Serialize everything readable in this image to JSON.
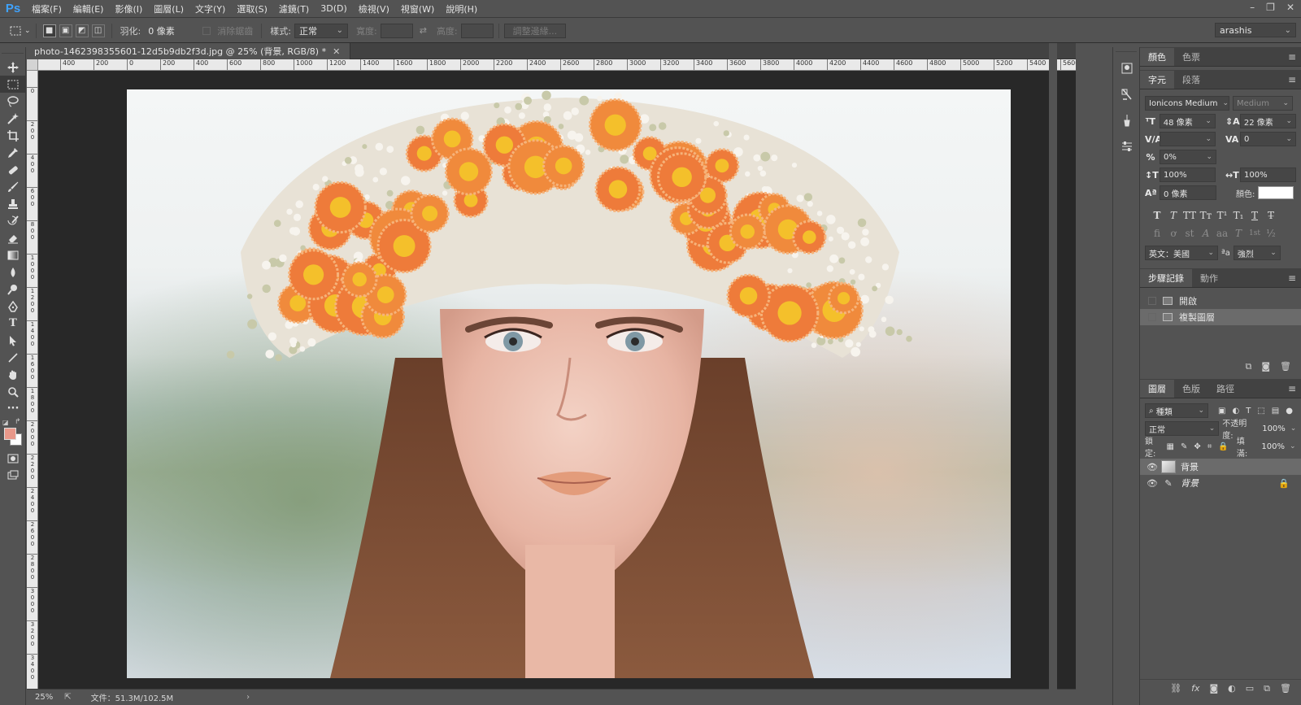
{
  "app": {
    "logo": "Ps"
  },
  "menu": [
    "檔案(F)",
    "編輯(E)",
    "影像(I)",
    "圖層(L)",
    "文字(Y)",
    "選取(S)",
    "濾鏡(T)",
    "3D(D)",
    "檢視(V)",
    "視窗(W)",
    "說明(H)"
  ],
  "options": {
    "feather_label": "羽化:",
    "feather_value": "0 像素",
    "antialias_label": "消除鋸齒",
    "style_label": "樣式:",
    "style_value": "正常",
    "width_label": "寬度:",
    "height_label": "高度:",
    "refine_label": "調整邊緣...",
    "workspace": "arashis"
  },
  "document": {
    "tab_title": "photo-1462398355601-12d5b9db2f3d.jpg @ 25% (背景, RGB/8) *",
    "ruler_ticks": [
      "400",
      "200",
      "0",
      "200",
      "400",
      "600",
      "800",
      "1000",
      "1200",
      "1400",
      "1600",
      "1800",
      "2000",
      "2200",
      "2400",
      "2600",
      "2800",
      "3000",
      "3200",
      "3400",
      "3600",
      "3800",
      "4000",
      "4200",
      "4400",
      "4600",
      "4800",
      "5000",
      "5200",
      "5400",
      "5600"
    ],
    "vruler_ticks": [
      "0",
      "2 0 0",
      "4 0 0",
      "6 0 0",
      "8 0 0",
      "1 0 0 0",
      "1 2 0 0",
      "1 4 0 0",
      "1 6 0 0",
      "1 8 0 0",
      "2 0 0 0",
      "2 2 0 0",
      "2 4 0 0",
      "2 6 0 0",
      "2 8 0 0",
      "3 0 0 0",
      "3 2 0 0",
      "3 4 0 0"
    ],
    "zoom": "25%",
    "file_info": "文件：51.3M/102.5M"
  },
  "colors": {
    "foreground": "#e8988a",
    "background": "#ffffff"
  },
  "character_panel": {
    "tabs": [
      "顏色",
      "色票"
    ],
    "subtabs": [
      "字元",
      "段落"
    ],
    "font_family": "Ionicons Medium",
    "font_style": "Medium",
    "size": "48 像素",
    "leading": "22 像素",
    "kerning": "",
    "tracking": "0",
    "tsume": "0%",
    "vscale": "100%",
    "hscale": "100%",
    "baseline": "0 像素",
    "color_label": "顏色:",
    "format_buttons": [
      "T",
      "T",
      "TT",
      "Tт",
      "T¹",
      "T₁",
      "T",
      "T̶"
    ],
    "opentype_buttons": [
      "fi",
      "ơ",
      "st",
      "A",
      "aa",
      "T",
      "1st",
      "½"
    ],
    "language": "英文：美國",
    "aa_icon": "ªa",
    "aa_mode": "強烈"
  },
  "history_panel": {
    "tabs": [
      "步驟記錄",
      "動作"
    ],
    "items": [
      "開啟",
      "複製圖層"
    ]
  },
  "layers_panel": {
    "tabs": [
      "圖層",
      "色版",
      "路徑"
    ],
    "filter": "種類",
    "blend_mode": "正常",
    "opacity_label": "不透明度:",
    "opacity": "100%",
    "lock_label": "鎖定:",
    "fill_label": "填滿:",
    "fill": "100%",
    "layers": [
      "背景",
      "背景"
    ]
  }
}
